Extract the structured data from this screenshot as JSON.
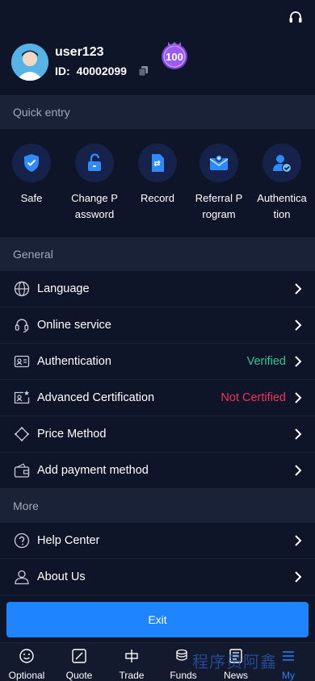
{
  "header": {
    "support_icon": "headset-icon"
  },
  "profile": {
    "username": "user123",
    "id_label": "ID:",
    "id_value": "40002099",
    "level_badge": "100"
  },
  "quick_entry": {
    "title": "Quick entry",
    "items": [
      {
        "label": "Safe",
        "icon": "shield-icon"
      },
      {
        "label": "Change P assword",
        "icon": "unlock-icon"
      },
      {
        "label": "Record",
        "icon": "record-doc-icon"
      },
      {
        "label": "Referral P rogram",
        "icon": "referral-mail-icon"
      },
      {
        "label": "Authentica tion",
        "icon": "user-verified-icon"
      }
    ]
  },
  "general": {
    "title": "General",
    "items": [
      {
        "label": "Language",
        "status": "",
        "icon": "globe-icon"
      },
      {
        "label": "Online service",
        "status": "",
        "icon": "headset-icon"
      },
      {
        "label": "Authentication",
        "status": "Verified",
        "icon": "id-card-icon"
      },
      {
        "label": "Advanced Certification",
        "status": "Not Certified",
        "icon": "id-card-star-icon"
      },
      {
        "label": "Price Method",
        "status": "",
        "icon": "diamond-icon"
      },
      {
        "label": "Add payment method",
        "status": "",
        "icon": "wallet-icon"
      }
    ]
  },
  "more": {
    "title": "More",
    "items": [
      {
        "label": "Help Center",
        "icon": "question-circle-icon"
      },
      {
        "label": "About Us",
        "icon": "user-outline-icon"
      }
    ]
  },
  "exit_label": "Exit",
  "bottom_nav": [
    {
      "label": "Optional",
      "icon": "smile-icon"
    },
    {
      "label": "Quote",
      "icon": "chart-box-icon"
    },
    {
      "label": "Trade",
      "icon": "trade-icon"
    },
    {
      "label": "Funds",
      "icon": "coins-icon"
    },
    {
      "label": "News",
      "icon": "news-icon"
    },
    {
      "label": "My",
      "icon": "menu-icon",
      "active": true
    }
  ],
  "watermark": "程序员阿鑫",
  "colors": {
    "accent": "#1f84ff",
    "verified": "#28c792",
    "not_certified": "#f0335d",
    "background": "#0f1528"
  }
}
